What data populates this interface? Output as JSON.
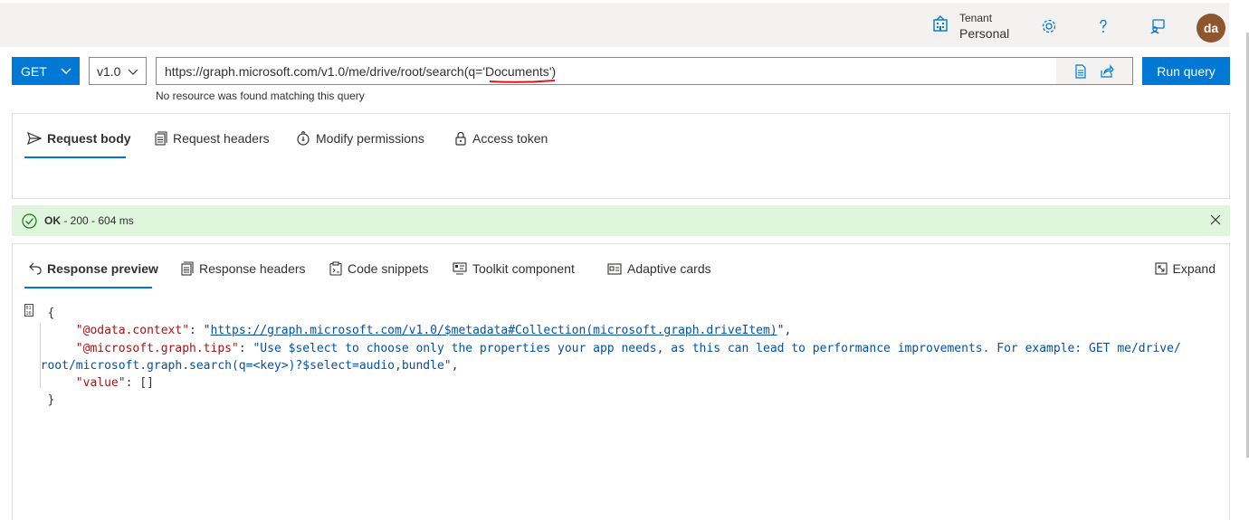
{
  "header": {
    "tenant_label": "Tenant",
    "tenant_value": "Personal",
    "avatar_initials": "da"
  },
  "query": {
    "method": "GET",
    "version": "v1.0",
    "url_prefix": "https://graph.microsoft.com/v1.0/me/drive/root/search(q='",
    "url_highlight": "Documents",
    "url_suffix": "')",
    "error_message": "No resource was found matching this query",
    "run_label": "Run query"
  },
  "request_tabs": [
    {
      "label": "Request body",
      "icon": "send-icon",
      "active": true
    },
    {
      "label": "Request headers",
      "icon": "headers-icon",
      "active": false
    },
    {
      "label": "Modify permissions",
      "icon": "permissions-icon",
      "active": false
    },
    {
      "label": "Access token",
      "icon": "lock-icon",
      "active": false
    }
  ],
  "status": {
    "ok": "OK",
    "detail": "- 200 - 604 ms"
  },
  "response_tabs": [
    {
      "label": "Response preview",
      "icon": "undo-icon",
      "active": true
    },
    {
      "label": "Response headers",
      "icon": "headers-icon",
      "active": false
    },
    {
      "label": "Code snippets",
      "icon": "clipboard-icon",
      "active": false
    },
    {
      "label": "Toolkit component",
      "icon": "toolkit-icon",
      "active": false
    },
    {
      "label": "Adaptive cards",
      "icon": "card-icon",
      "active": false
    }
  ],
  "expand_label": "Expand",
  "response_json": {
    "open_brace": "{",
    "context_key": "\"@odata.context\"",
    "context_value": "https://graph.microsoft.com/v1.0/$metadata#Collection(microsoft.graph.driveItem)",
    "tips_key": "\"@microsoft.graph.tips\"",
    "tips_value_line1": "\"Use $select to choose only the properties your app needs, as this can lead to performance improvements. For example: GET me/drive/",
    "tips_value_line2": "root/microsoft.graph.search(q=<key>)?$select=audio,bundle\"",
    "value_key": "\"value\"",
    "value_value": "[]",
    "close_brace": "}"
  },
  "colors": {
    "accent": "#0078d4",
    "success_bg": "#dff6dd",
    "success_icon": "#107c10",
    "avatar_bg": "#8e562e",
    "error_underline": "#e81123"
  }
}
